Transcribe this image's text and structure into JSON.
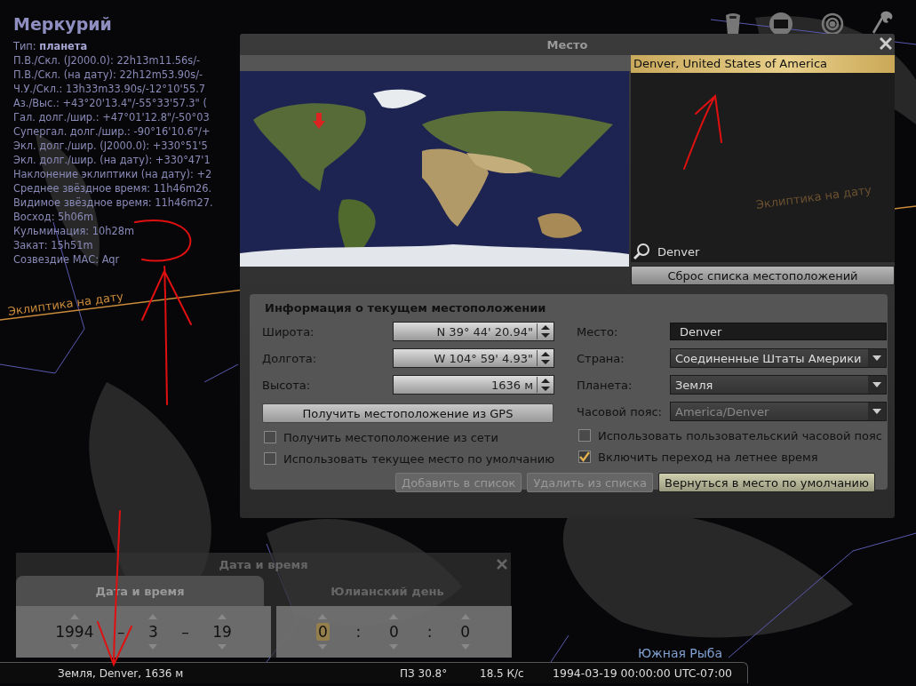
{
  "info": {
    "title": "Меркурий",
    "lines": [
      "Тип: **планета**",
      "П.В./Скл. (J2000.0): 22h13m11.56s/-",
      "П.В./Скл. (на дату): 22h12m53.90s/-",
      "Ч.У./Скл.: 13h33m33.90s/-12°10'55.7",
      "Аз./Выс.: +43°20'13.4\"/-55°33'57.3\" (",
      "Гал. долг./шир.: +47°01'12.8\"/-50°03",
      "Супергал. долг./шир.: -90°16'10.6\"/+",
      "Экл. долг./шир. (J2000.0): +330°51'5",
      "Экл. долг./шир. (на дату): +330°47'1",
      "Наклонение эклиптики (на дату): +2",
      "Среднее звёздное время: 11h46m26.",
      "Видимое звёздное время: 11h46m27.",
      "Восход: 5h06m",
      "Кульминация: 10h28m",
      "Закат: 15h51m",
      "Созвездие МАС: Aqr"
    ]
  },
  "ecliptic_labels": [
    "Эклиптика на дату",
    "Эклиптика на дату"
  ],
  "constellation_label": "Южная Рыба",
  "location_dialog": {
    "title": "Место",
    "locations": [
      {
        "label": "Denver, United States of America",
        "selected": true
      }
    ],
    "search": {
      "value": "Denver"
    },
    "reset_button": "Сброс списка местоположений",
    "info": {
      "heading": "Информация о текущем местоположении",
      "left_fields": [
        {
          "label": "Широта:",
          "value": "N 39° 44' 20.94\""
        },
        {
          "label": "Долгота:",
          "value": "W 104° 59' 4.93\""
        },
        {
          "label": "Высота:",
          "value": "1636 м"
        }
      ],
      "gps_button": "Получить местоположение из GPS",
      "left_checks": [
        {
          "label": "Получить местоположение из сети",
          "checked": false
        },
        {
          "label": "Использовать текущее место по умолчанию",
          "checked": false
        }
      ],
      "right_fields": [
        {
          "label": "Место:",
          "kind": "text",
          "value": "Denver",
          "disabled": false
        },
        {
          "label": "Страна:",
          "kind": "combo",
          "value": "Соединенные Штаты Америки",
          "disabled": false
        },
        {
          "label": "Планета:",
          "kind": "combo",
          "value": "Земля",
          "disabled": false
        },
        {
          "label": "Часовой пояс:",
          "kind": "combo",
          "value": "America/Denver",
          "disabled": true
        }
      ],
      "right_checks": [
        {
          "label": "Использовать пользовательский часовой пояс",
          "checked": false
        },
        {
          "label": "Включить переход на летнее время",
          "checked": true
        }
      ],
      "buttons": [
        {
          "label": "Добавить в список",
          "disabled": true
        },
        {
          "label": "Удалить из списка",
          "disabled": true
        },
        {
          "label": "Вернуться в место по умолчанию",
          "disabled": false
        }
      ]
    }
  },
  "date_panel": {
    "title": "Дата и время",
    "tabs": [
      {
        "label": "Дата и время",
        "selected": true
      },
      {
        "label": "Юлианский день",
        "selected": false
      }
    ],
    "date_fields": [
      {
        "value": "1994",
        "focused": false
      },
      {
        "value": "3",
        "focused": false
      },
      {
        "value": "19",
        "focused": false
      }
    ],
    "date_separators": [
      "–",
      "–"
    ],
    "time_fields": [
      {
        "value": "0",
        "focused": true
      },
      {
        "value": "0",
        "focused": false
      },
      {
        "value": "0",
        "focused": false
      }
    ],
    "time_separators": [
      ":",
      ":"
    ]
  },
  "status_bar": {
    "location": "Земля, Denver, 1636 м",
    "fov": "ПЗ 30.8°",
    "fps": "18.5 К/с",
    "datetime": "1994-03-19 00:00:00 UTC-07:00"
  }
}
